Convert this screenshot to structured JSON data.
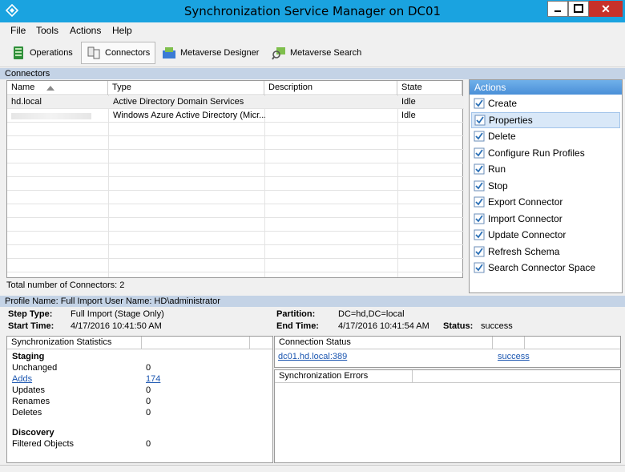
{
  "window": {
    "title": "Synchronization Service Manager on DC01",
    "accent": "#1aa3e0"
  },
  "menu": [
    "File",
    "Tools",
    "Actions",
    "Help"
  ],
  "toolbar": {
    "operations": "Operations",
    "connectors": "Connectors",
    "metaverse_designer": "Metaverse Designer",
    "metaverse_search": "Metaverse Search"
  },
  "connectors": {
    "section_title": "Connectors",
    "columns": [
      "Name",
      "Type",
      "Description",
      "State"
    ],
    "rows": [
      {
        "name": "hd.local",
        "type": "Active Directory Domain Services",
        "description": "",
        "state": "Idle"
      },
      {
        "name": "",
        "type": "Windows Azure Active Directory (Micr...",
        "description": "",
        "state": "Idle"
      }
    ],
    "total": "Total number of Connectors: 2"
  },
  "actions": {
    "header": "Actions",
    "items": [
      "Create",
      "Properties",
      "Delete",
      "Configure Run Profiles",
      "Run",
      "Stop",
      "Export Connector",
      "Import Connector",
      "Update Connector",
      "Refresh Schema",
      "Search Connector Space"
    ],
    "selected": "Properties"
  },
  "profile": {
    "header": "Profile Name: Full Import  User Name: HD\\administrator",
    "step_type_label": "Step Type:",
    "step_type": "Full Import (Stage Only)",
    "start_time_label": "Start Time:",
    "start_time": "4/17/2016 10:41:50 AM",
    "partition_label": "Partition:",
    "partition": "DC=hd,DC=local",
    "end_time_label": "End Time:",
    "end_time": "4/17/2016 10:41:54 AM",
    "status_label": "Status:",
    "status": "success"
  },
  "sync_stats": {
    "header": "Synchronization Statistics",
    "staging_title": "Staging",
    "staging": [
      {
        "label": "Unchanged",
        "value": "0",
        "link": false
      },
      {
        "label": "Adds",
        "value": "174",
        "link": true
      },
      {
        "label": "Updates",
        "value": "0",
        "link": false
      },
      {
        "label": "Renames",
        "value": "0",
        "link": false
      },
      {
        "label": "Deletes",
        "value": "0",
        "link": false
      }
    ],
    "discovery_title": "Discovery",
    "discovery": [
      {
        "label": "Filtered Objects",
        "value": "0"
      }
    ]
  },
  "connection_status": {
    "header": "Connection Status",
    "server": "dc01.hd.local:389",
    "result": "success"
  },
  "sync_errors": {
    "header": "Synchronization Errors"
  }
}
